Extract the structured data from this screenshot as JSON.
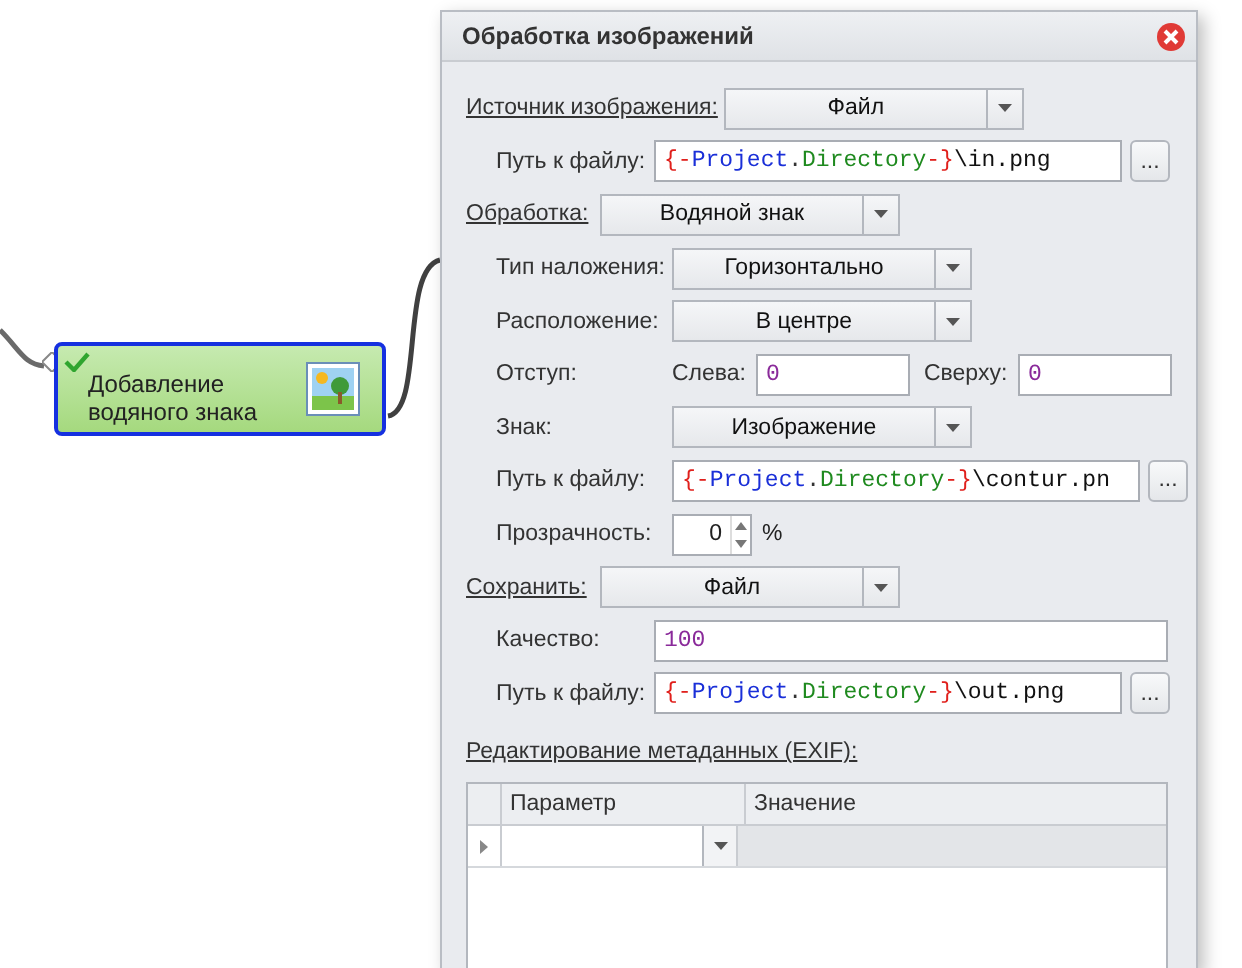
{
  "canvas_node": {
    "label": "Добавление водяного знака",
    "checked": true,
    "selected": true
  },
  "dialog": {
    "title": "Обработка изображений",
    "sections": [
      {
        "label": "Источник изображения:",
        "value": "Файл",
        "kind": "wide",
        "rows": [
          {
            "kind": "path",
            "label": "Путь к файлу:",
            "segments": [
              {
                "kind": "brace",
                "text": "{-"
              },
              {
                "kind": "name",
                "text": "Project"
              },
              {
                "kind": "dot",
                "text": "."
              },
              {
                "kind": "member",
                "text": "Directory"
              },
              {
                "kind": "brace",
                "text": "-}"
              },
              {
                "kind": "plain",
                "text": "\\in.png"
              }
            ],
            "button": "..."
          }
        ]
      },
      {
        "label": "Обработка:",
        "value": "Водяной знак",
        "kind": "narrow",
        "rows": [
          {
            "kind": "combo",
            "label": "Тип наложения:",
            "value": "Горизонтально"
          },
          {
            "kind": "combo",
            "label": "Расположение:",
            "value": "В центре"
          },
          {
            "kind": "offset",
            "label": "Отступ:",
            "left_label": "Слева:",
            "left_value": "0",
            "top_label": "Сверху:",
            "top_value": "0"
          },
          {
            "kind": "combo",
            "label": "Знак:",
            "value": "Изображение"
          },
          {
            "kind": "path",
            "label": "Путь к файлу:",
            "segments": [
              {
                "kind": "brace",
                "text": "{-"
              },
              {
                "kind": "name",
                "text": "Project"
              },
              {
                "kind": "dot",
                "text": "."
              },
              {
                "kind": "member",
                "text": "Directory"
              },
              {
                "kind": "brace",
                "text": "-}"
              },
              {
                "kind": "plain",
                "text": "\\contur.pn"
              }
            ],
            "button": "..."
          },
          {
            "kind": "spin",
            "label": "Прозрачность:",
            "value": "0",
            "unit": "%"
          }
        ]
      },
      {
        "label": "Сохранить:",
        "value": "Файл",
        "kind": "narrow",
        "rows": [
          {
            "kind": "text",
            "label": "Качество:",
            "value": "100"
          },
          {
            "kind": "path",
            "label": "Путь к файлу:",
            "segments": [
              {
                "kind": "brace",
                "text": "{-"
              },
              {
                "kind": "name",
                "text": "Project"
              },
              {
                "kind": "dot",
                "text": "."
              },
              {
                "kind": "member",
                "text": "Directory"
              },
              {
                "kind": "brace",
                "text": "-}"
              },
              {
                "kind": "plain",
                "text": "\\out.png"
              }
            ],
            "button": "..."
          }
        ]
      }
    ],
    "exif_label": "Редактирование метаданных (EXIF):",
    "table": {
      "columns": [
        "Параметр",
        "Значение"
      ],
      "current_row": true
    }
  }
}
